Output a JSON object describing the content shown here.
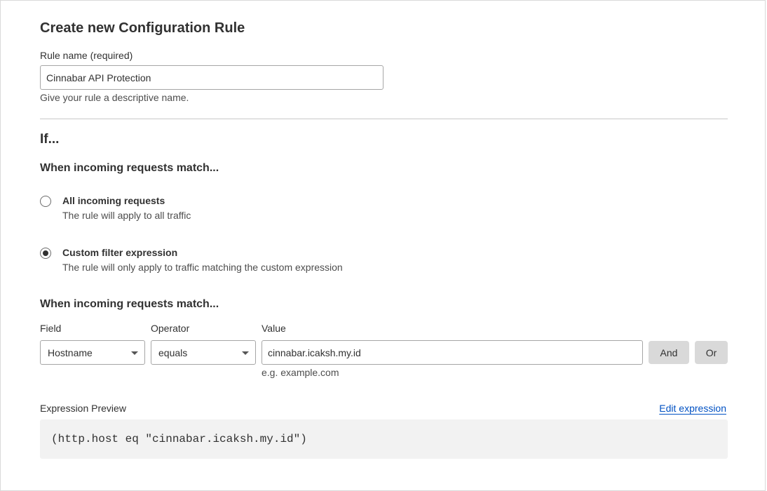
{
  "form": {
    "title": "Create new Configuration Rule",
    "rule_name_label": "Rule name (required)",
    "rule_name_value": "Cinnabar API Protection",
    "rule_name_help": "Give your rule a descriptive name."
  },
  "if_section": {
    "heading": "If...",
    "match_heading": "When incoming requests match...",
    "options": [
      {
        "title": "All incoming requests",
        "desc": "The rule will apply to all traffic",
        "selected": false
      },
      {
        "title": "Custom filter expression",
        "desc": "The rule will only apply to traffic matching the custom expression",
        "selected": true
      }
    ]
  },
  "builder": {
    "heading": "When incoming requests match...",
    "field_label": "Field",
    "field_value": "Hostname",
    "operator_label": "Operator",
    "operator_value": "equals",
    "value_label": "Value",
    "value_value": "cinnabar.icaksh.my.id",
    "value_hint": "e.g. example.com",
    "and_label": "And",
    "or_label": "Or"
  },
  "preview": {
    "label": "Expression Preview",
    "edit_link": "Edit expression",
    "expression": "(http.host eq \"cinnabar.icaksh.my.id\")"
  },
  "icons": {
    "dropdown": "chevron-down-icon",
    "radio": "radio-icon"
  }
}
